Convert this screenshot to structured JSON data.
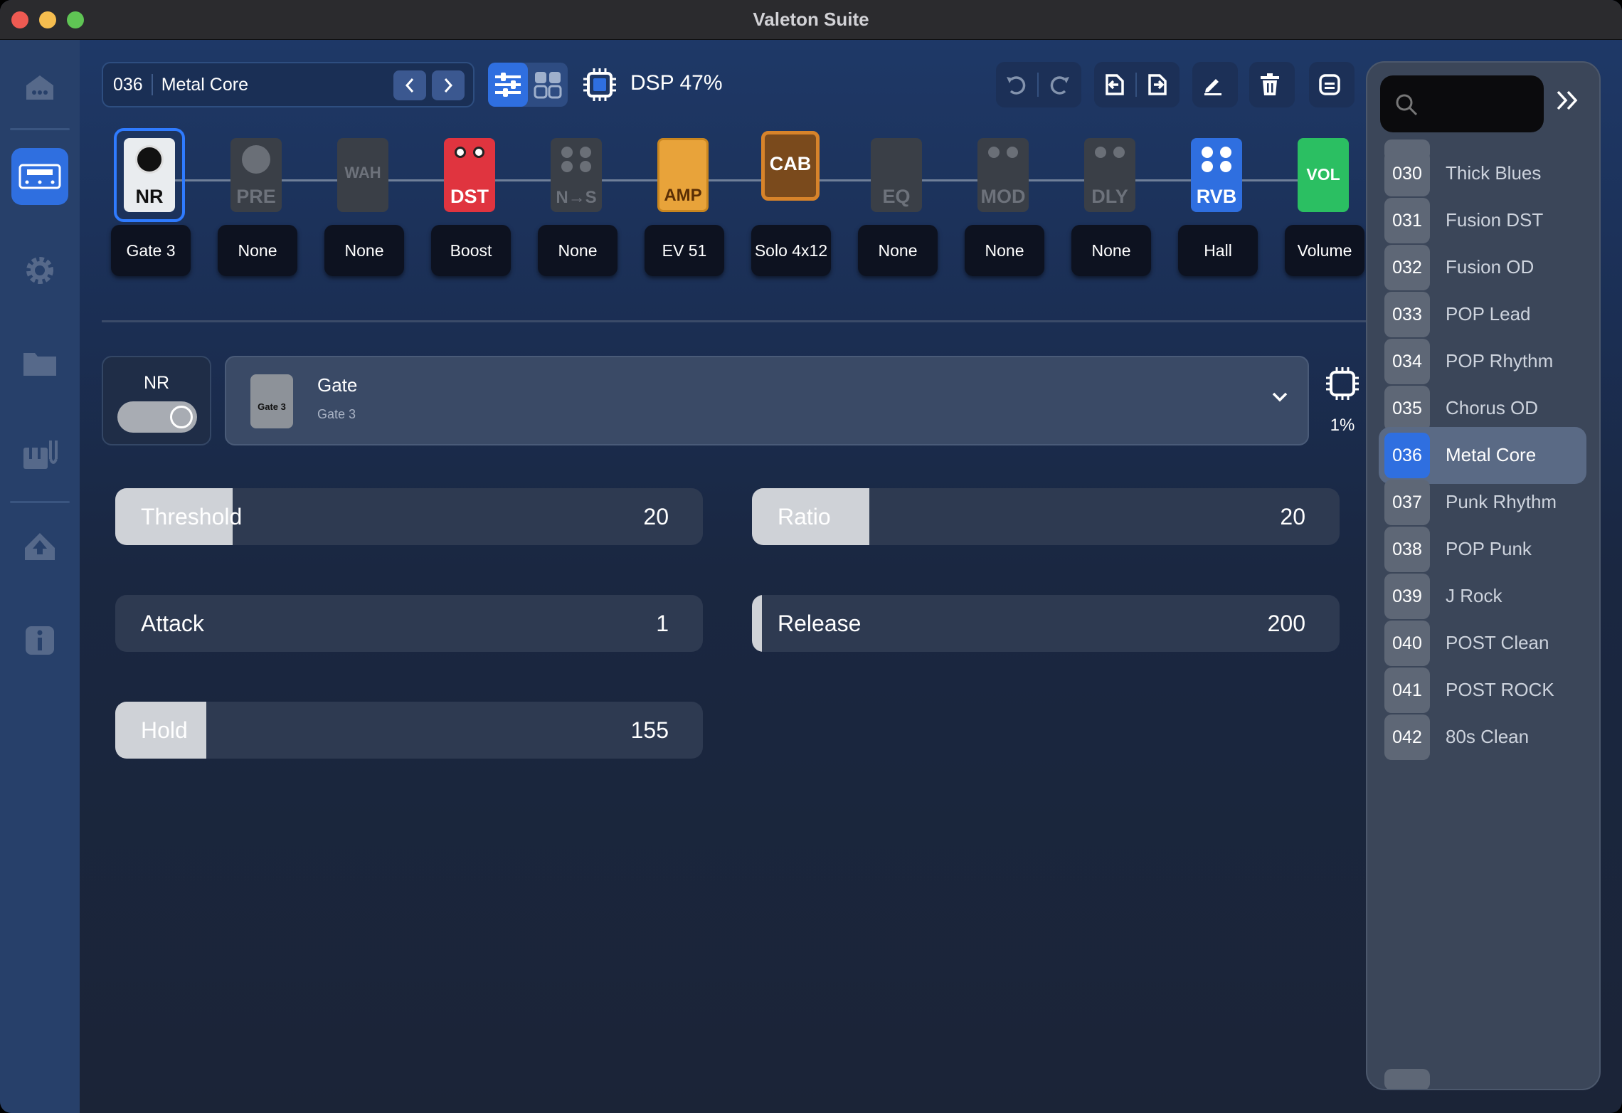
{
  "window": {
    "title": "Valeton Suite"
  },
  "sidebar": {
    "items": [
      {
        "name": "home-icon",
        "active": false
      },
      {
        "name": "device-icon",
        "active": true
      },
      {
        "name": "gear-icon",
        "active": false
      },
      {
        "name": "folder-icon",
        "active": false
      },
      {
        "name": "mixer-icon",
        "active": false
      },
      {
        "name": "upload-icon",
        "active": false
      },
      {
        "name": "info-icon",
        "active": false
      }
    ]
  },
  "preset": {
    "number": "036",
    "name": "Metal Core"
  },
  "dsp": {
    "label": "DSP 47%"
  },
  "chain": [
    {
      "tag": "NR",
      "label": "Gate 3"
    },
    {
      "tag": "PRE",
      "label": "None"
    },
    {
      "tag": "WAH",
      "label": "None"
    },
    {
      "tag": "DST",
      "label": "Boost"
    },
    {
      "tag": "N→S",
      "label": "None"
    },
    {
      "tag": "AMP",
      "label": "EV 51"
    },
    {
      "tag": "CAB",
      "label": "Solo 4x12"
    },
    {
      "tag": "EQ",
      "label": "None"
    },
    {
      "tag": "MOD",
      "label": "None"
    },
    {
      "tag": "DLY",
      "label": "None"
    },
    {
      "tag": "RVB",
      "label": "Hall"
    },
    {
      "tag": "VOL",
      "label": "Volume"
    }
  ],
  "module": {
    "toggle_label": "NR",
    "enabled": true,
    "effect_name": "Gate",
    "effect_sub": "Gate 3",
    "thumb_label": "Gate 3",
    "dsp_usage": "1%"
  },
  "params": [
    {
      "label": "Threshold",
      "value": "20",
      "fill": 0.2
    },
    {
      "label": "Ratio",
      "value": "20",
      "fill": 0.2
    },
    {
      "label": "Attack",
      "value": "1",
      "fill": 0.0
    },
    {
      "label": "Release",
      "value": "200",
      "fill": 0.02
    },
    {
      "label": "Hold",
      "value": "155",
      "fill": 0.155
    }
  ],
  "presets": [
    {
      "num": "030",
      "name": "Thick Blues"
    },
    {
      "num": "031",
      "name": "Fusion DST"
    },
    {
      "num": "032",
      "name": "Fusion OD"
    },
    {
      "num": "033",
      "name": "POP Lead"
    },
    {
      "num": "034",
      "name": "POP Rhythm"
    },
    {
      "num": "035",
      "name": "Chorus OD"
    },
    {
      "num": "036",
      "name": "Metal Core",
      "active": true
    },
    {
      "num": "037",
      "name": "Punk Rhythm"
    },
    {
      "num": "038",
      "name": "POP Punk"
    },
    {
      "num": "039",
      "name": "J Rock"
    },
    {
      "num": "040",
      "name": "POST Clean"
    },
    {
      "num": "041",
      "name": "POST ROCK"
    },
    {
      "num": "042",
      "name": "80s Clean"
    }
  ],
  "colors": {
    "accent": "#2f6fe0",
    "dst": "#e0343f",
    "amp": "#e8a33a",
    "vol": "#2bbf62"
  }
}
